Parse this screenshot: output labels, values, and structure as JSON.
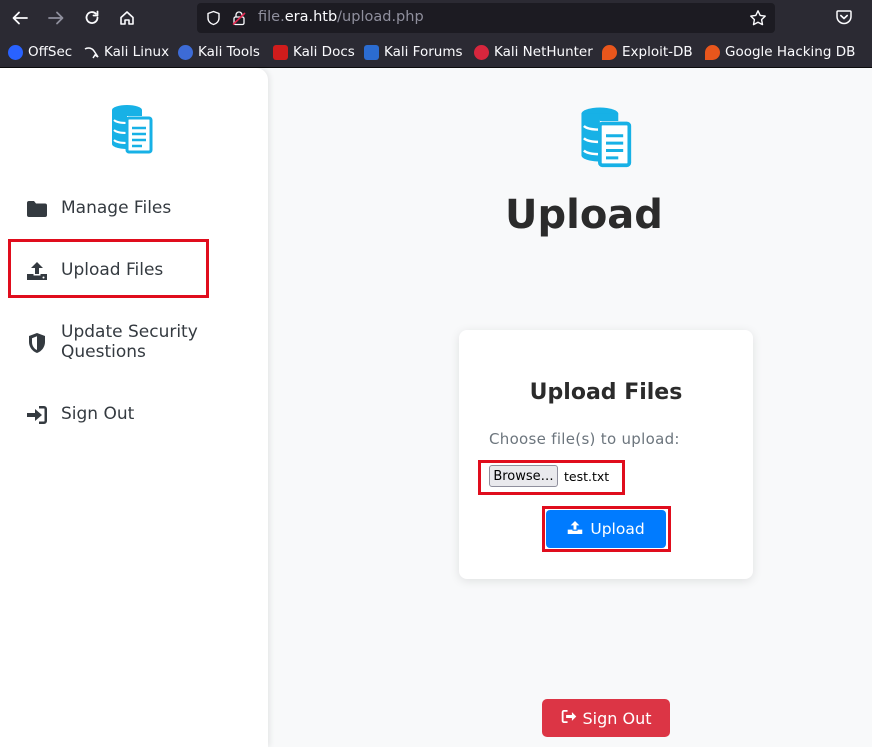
{
  "browser": {
    "url_prefix": "file.",
    "url_host": "era.htb",
    "url_path": "/upload.php",
    "bookmarks": [
      {
        "label": "OffSec",
        "icon": "offsec-icon"
      },
      {
        "label": "Kali Linux",
        "icon": "kali-dragon-icon"
      },
      {
        "label": "Kali Tools",
        "icon": "kali-tools-icon"
      },
      {
        "label": "Kali Docs",
        "icon": "kali-docs-icon"
      },
      {
        "label": "Kali Forums",
        "icon": "kali-forums-icon"
      },
      {
        "label": "Kali NetHunter",
        "icon": "nethunter-icon"
      },
      {
        "label": "Exploit-DB",
        "icon": "exploit-db-icon"
      },
      {
        "label": "Google Hacking DB",
        "icon": "ghdb-icon"
      }
    ]
  },
  "sidebar": {
    "logo_icon": "database-file-icon",
    "items": [
      {
        "label": "Manage Files",
        "icon": "folder-icon"
      },
      {
        "label": "Upload Files",
        "icon": "upload-icon"
      },
      {
        "label": "Update Security Questions",
        "icon": "shield-icon"
      },
      {
        "label": "Sign Out",
        "icon": "sign-in-icon"
      }
    ]
  },
  "main": {
    "title": "Upload",
    "card": {
      "title": "Upload Files",
      "label": "Choose file(s) to upload:",
      "browse_label": "Browse…",
      "file_name": "test.txt",
      "upload_label": "Upload"
    },
    "signout_label": "Sign Out"
  },
  "colors": {
    "accent": "#007bff",
    "danger": "#dc3545",
    "logo": "#17b1e6",
    "highlight": "#e00d1d"
  }
}
